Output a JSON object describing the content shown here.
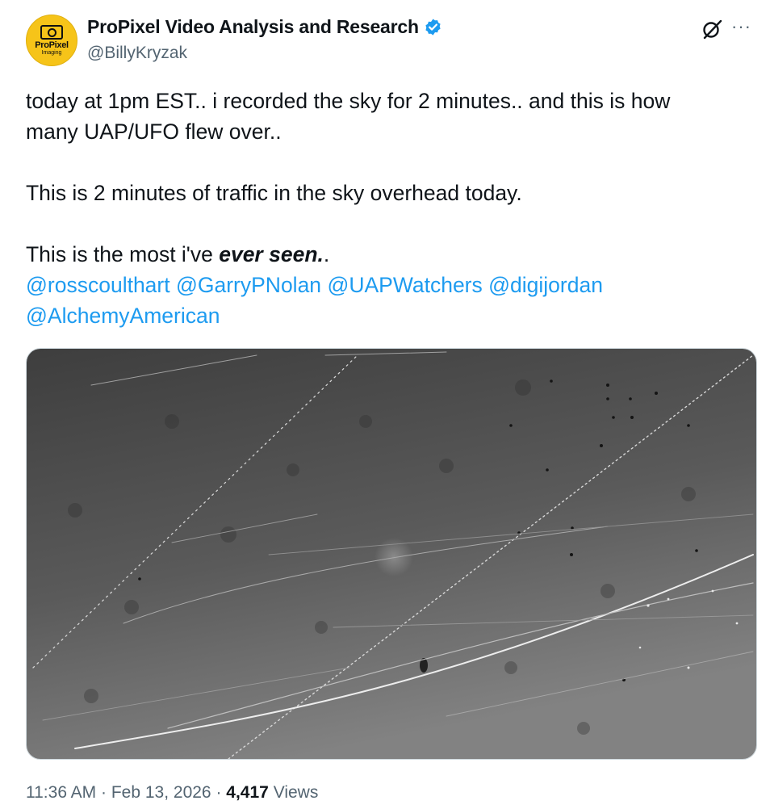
{
  "author": {
    "display_name": "ProPixel Video Analysis and Research",
    "handle": "@BillyKryzak",
    "avatar_brand": "ProPixel",
    "avatar_sub": "Imaging",
    "verified": true
  },
  "tweet": {
    "line1": "today at 1pm EST..  i recorded the sky for 2 minutes.. and this is how",
    "line2": "many UAP/UFO flew over..",
    "line3": "This is 2 minutes of traffic in the sky overhead today.",
    "line4_prefix": "This is the most i've ",
    "line4_emphasis": "ever seen.",
    "line4_suffix": ".",
    "mentions": [
      "@rosscoulthart",
      "@GarryPNolan",
      "@UAPWatchers",
      "@digijordan",
      "@AlchemyAmerican"
    ]
  },
  "meta": {
    "time": "11:36 AM",
    "date": "Feb 13, 2026",
    "views_count": "4,417",
    "views_label": "Views"
  },
  "colors": {
    "link": "#1d9bf0",
    "verified": "#1d9bf0",
    "secondary": "#536471"
  }
}
